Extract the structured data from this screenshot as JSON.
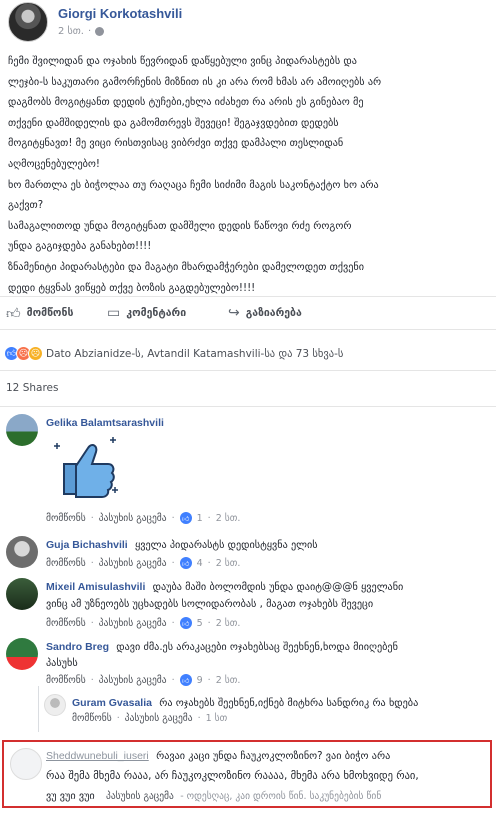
{
  "post": {
    "author": "Giorgi Korkotashvili",
    "time": "2 სთ.",
    "body_lines": [
      "ჩემი შვილიდან და ოჯახის წევრიდან დაწყებული ვინც პიდარასტებს და",
      "ლეჯბი-ს საკუთარი გამორჩენის მიზნით ის კი არა რომ ხმას არ ამოიღებს არ",
      "დაგმობს მოგიტყანთ დედის ტუჩები,ეხლა იძახეთ რა არის ეს გინებაო მე",
      "თქვენი დამშიდელის და გამომთრევს შევეცი! შეგაჯვდებით დედებს",
      "მოგიტყნავთ! მე ვიცი რისთვისაც ვიბრძვი თქვე დამპალი თესლიდან",
      "აღმოცენებულებო!",
      "ხო მართლა ეს ბიჭოლაა თუ რაღაცა ჩემი სიძიმი მაგის საკონტაქტო ხო არა",
      "გაქვთ?",
      "სამაგალითოდ უნდა მოგიტყნათ დამშელი დედის წაწოვი რძე როგორ",
      "უნდა გაგიჯდება განახებთ!!!!",
      "ზნამენიტი პიდარასტები და მაგატი მხარდამჭერები დამელოდეთ თქვენი",
      "დედი ტყვნას ვიწყებ თქვე ბოზის გაგდებულებო!!!!"
    ]
  },
  "actions": {
    "like": "მომწონს",
    "comment": "კომენტარი",
    "share": "გაზიარება"
  },
  "reactions_summary": "Dato Abzianidze-ს, Avtandil Katamashvili-სა და 73 სხვა-ს",
  "shares": "12 Shares",
  "comment_actions": {
    "like": "მომწონს",
    "reply": "პასუხის გაცემა"
  },
  "comments": [
    {
      "name": "Gelika Balamtsarashvili",
      "text": "",
      "likes": "1",
      "time": "2 სთ."
    },
    {
      "name": "Guja Bichashvili",
      "text": "ყველა პიდარასტს დედისტყვნა ელის",
      "likes": "4",
      "time": "2 სთ."
    },
    {
      "name": "Mixeil Amisulashvili",
      "line1": "დაუბა მაში ბოლომდის უნდა დაიტ@@@ნ ყველანი",
      "line2": "ვინც ამ უზნეოებს უცხადებს სოლიდარობას , მაგათ ოჯახებს შევეცი",
      "likes": "5",
      "time": "2 სთ."
    },
    {
      "name": "Sandro Breg",
      "line1": "დავი ძმა.ეს არაკაცები ოჯახებსაც შეეხნენ,ხოდა მიიღებენ",
      "line2": "პასუხს",
      "likes": "9",
      "time": "2 სთ."
    }
  ],
  "reply": {
    "name": "Guram Gvasalia",
    "text": "რა ოჯახებს შეეხნენ,იქნებ მიტხრა სანდრიკ რა ხდება",
    "time": "1 სთ"
  },
  "highlighted": {
    "name": "Sheddwunebuli_iuseri",
    "line1": "რავაი კაცი უნდა ჩაუკოკლოზინო? ვაი ბიჭო არა",
    "line2": "რაა შემა მხემა რააა, არ ჩაუკოკლოზინო რაააა, მხემა არა ხმოხვიდე რაი,",
    "line3": "ვუ ვუი ვუი",
    "reply_label": "პასუხის გაცემა",
    "meta": "- ოდესღაც, კაი დროის წინ. საკუნებების წინ"
  },
  "colors": {
    "link": "#365899",
    "highlight_border": "#d32f2f",
    "like_blue": "#4080ff"
  }
}
